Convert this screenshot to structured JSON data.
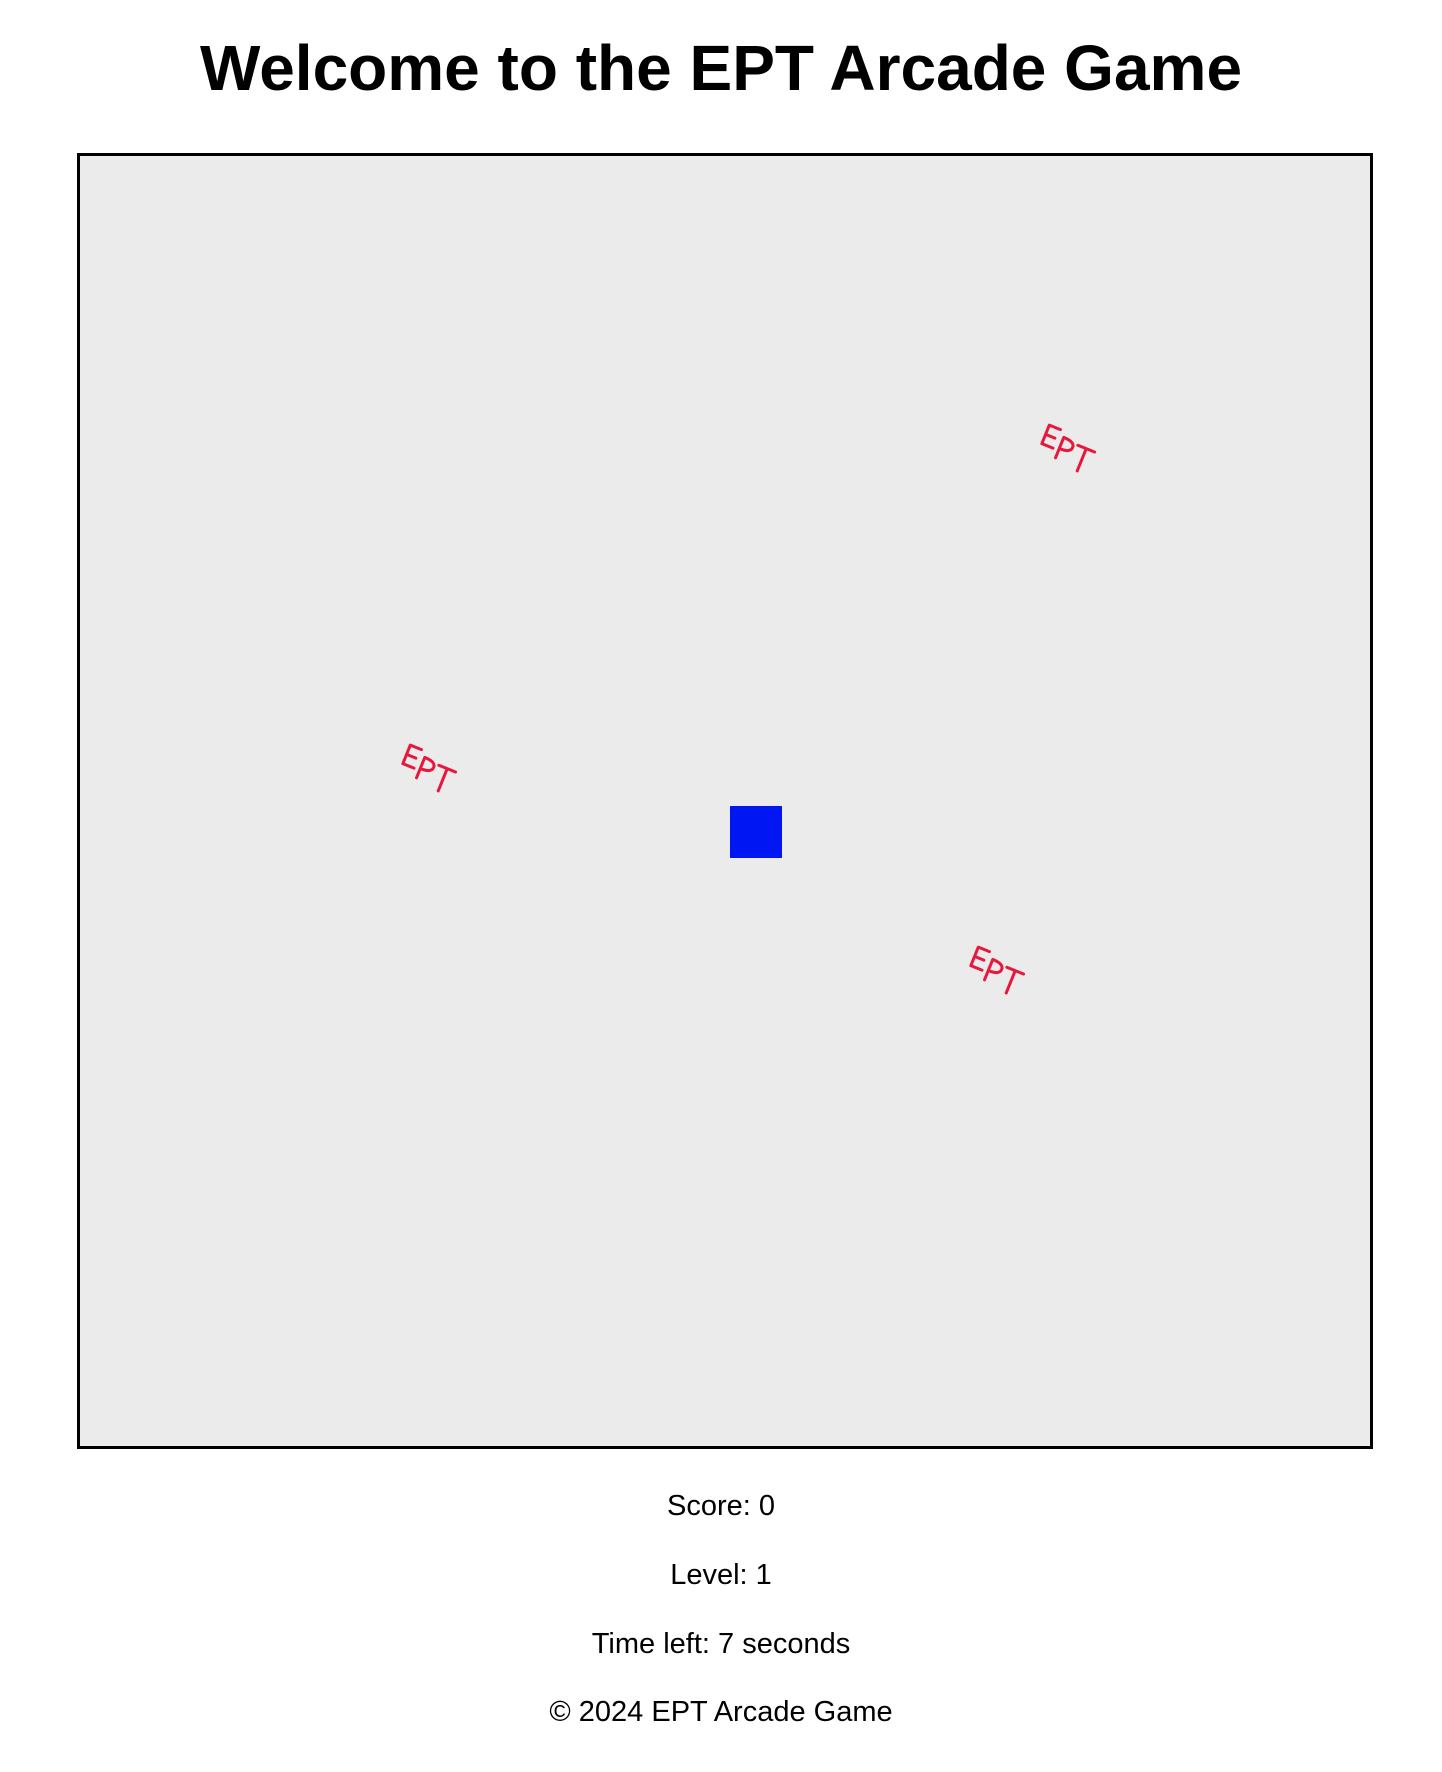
{
  "page_title": "Welcome to the EPT Arcade Game",
  "game": {
    "player_color": "#0016f2",
    "board_color": "#ebebeb",
    "token_color": "#e8173c",
    "token_text": "EPT",
    "token_count": 3
  },
  "status": {
    "score_label": "Score:",
    "score": "0",
    "level_label": "Level:",
    "level": "1",
    "time_label": "Time left:",
    "time_value": "7",
    "time_unit": "seconds"
  },
  "footer": {
    "text": "© 2024 EPT Arcade Game"
  }
}
